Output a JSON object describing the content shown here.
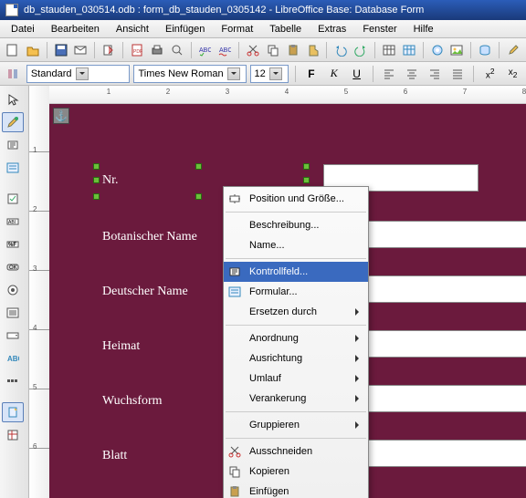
{
  "title": "db_stauden_030514.odb : form_db_stauden_0305142 - LibreOffice Base: Database Form",
  "menubar": [
    "Datei",
    "Bearbeiten",
    "Ansicht",
    "Einfügen",
    "Format",
    "Tabelle",
    "Extras",
    "Fenster",
    "Hilfe"
  ],
  "format": {
    "style": "Standard",
    "font": "Times New Roman",
    "size": "12"
  },
  "hruler": [
    "1",
    "2",
    "3",
    "4",
    "5",
    "6",
    "7",
    "8"
  ],
  "vruler": [
    "1",
    "2",
    "3",
    "4",
    "5",
    "6"
  ],
  "labels": {
    "nr": "Nr.",
    "botanischer": "Botanischer Name",
    "deutscher": "Deutscher Name",
    "heimat": "Heimat",
    "wuchsform": "Wuchsform",
    "blatt": "Blatt"
  },
  "context_menu": {
    "position": "Position und Größe...",
    "beschreibung": "Beschreibung...",
    "name": "Name...",
    "kontrollfeld": "Kontrollfeld...",
    "formular": "Formular...",
    "ersetzen": "Ersetzen durch",
    "anordnung": "Anordnung",
    "ausrichtung": "Ausrichtung",
    "umlauf": "Umlauf",
    "verankerung": "Verankerung",
    "gruppieren": "Gruppieren",
    "ausschneiden": "Ausschneiden",
    "kopieren": "Kopieren",
    "einfuegen": "Einfügen"
  }
}
